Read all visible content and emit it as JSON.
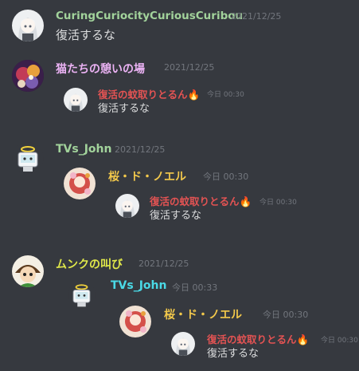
{
  "colors": {
    "background": "#36393f",
    "text": "#dcddde",
    "timestamp": "#72767d",
    "green": "#a2d39b",
    "pink": "#ecb3f5",
    "red": "#e35353",
    "yellow": "#f2c84b",
    "cyan": "#4ad9e6",
    "yellow_green": "#e0e84a"
  },
  "messages": [
    {
      "author": "CuringCuriocityCuriousCuribou",
      "timestamp": "2021/12/25",
      "content": "復活するな",
      "avatar_icon": "white-hair-girl-avatar-icon"
    },
    {
      "author": "猫たちの憩いの場",
      "timestamp": "2021/12/25",
      "avatar_icon": "cat-cafe-avatar-icon"
    },
    {
      "author": "復活の蚊取りとるん🔥",
      "timestamp": "今日 00:30",
      "content": "復活するな",
      "avatar_icon": "white-hair-girl-avatar-icon"
    },
    {
      "author": "TVs_John",
      "timestamp": "2021/12/25",
      "avatar_icon": "angel-tv-avatar-icon"
    },
    {
      "author": "桜・ド・ノエル",
      "timestamp": "今日 00:30",
      "avatar_icon": "sakura-avatar-icon"
    },
    {
      "author": "復活の蚊取りとるん🔥",
      "timestamp": "今日 00:30",
      "content": "復活するな",
      "avatar_icon": "white-hair-girl-avatar-icon"
    },
    {
      "author": "ムンクの叫び",
      "timestamp": "2021/12/25",
      "avatar_icon": "green-hat-avatar-icon"
    },
    {
      "author": "TVs_John",
      "timestamp": "今日 00:33",
      "avatar_icon": "angel-tv-avatar-icon"
    },
    {
      "author": "桜・ド・ノエル",
      "timestamp": "今日 00:30",
      "avatar_icon": "sakura-avatar-icon"
    },
    {
      "author": "復活の蚊取りとるん🔥",
      "timestamp": "今日 00:30",
      "content": "復活するな",
      "avatar_icon": "white-hair-girl-avatar-icon"
    }
  ]
}
